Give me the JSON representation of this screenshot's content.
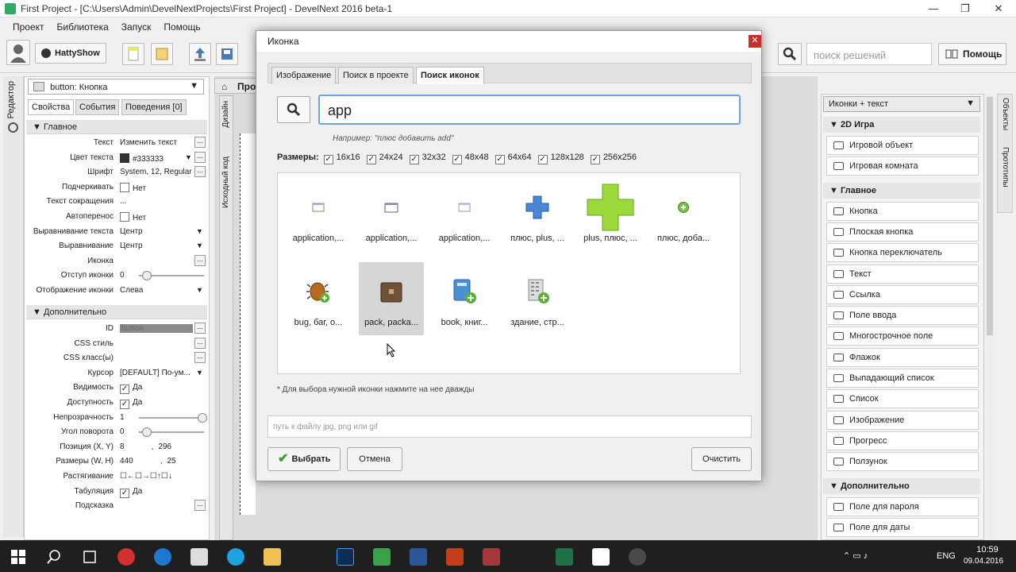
{
  "window": {
    "title": "First Project - [C:\\Users\\Admin\\DevelNextProjects\\First Project] - DevelNext 2016 beta-1"
  },
  "menu": [
    "Проект",
    "Библиотека",
    "Запуск",
    "Помощь"
  ],
  "toolbar": {
    "user": "HattyShow",
    "search_placeholder": "поиск решений",
    "help": "Помощь"
  },
  "editor_tab": "Редактор",
  "left": {
    "combo": "button: Кнопка",
    "tabs": [
      "Свойства",
      "События",
      "Поведения [0]"
    ],
    "main_section": "Главное",
    "extra_section": "Дополнительно",
    "props": [
      {
        "label": "Текст",
        "value": "Изменить текст",
        "dots": true
      },
      {
        "label": "Цвет текста",
        "value": "#333333",
        "swatch": true,
        "drop": true,
        "dots": true
      },
      {
        "label": "Шрифт",
        "value": "System, 12, Regular",
        "dots": true
      },
      {
        "label": "Подчеркивать",
        "value": "Нет",
        "check": false
      },
      {
        "label": "Текст сокращения",
        "value": "..."
      },
      {
        "label": "Автоперенос",
        "value": "Нет",
        "check": false
      },
      {
        "label": "Выравнивание текста",
        "value": "Центр",
        "drop": true
      },
      {
        "label": "Выравнивание",
        "value": "Центр",
        "drop": true
      },
      {
        "label": "Иконка",
        "value": "",
        "dots": true
      },
      {
        "label": "Отступ иконки",
        "value": "0",
        "slider": 0.05
      },
      {
        "label": "Отображение иконки",
        "value": "Слева",
        "drop": true
      }
    ],
    "props2": [
      {
        "label": "ID",
        "value": "button",
        "dots": true,
        "hl": true
      },
      {
        "label": "CSS стиль",
        "value": "",
        "dots": true
      },
      {
        "label": "CSS класс(ы)",
        "value": "",
        "dots": true
      },
      {
        "label": "Курсор",
        "value": "[DEFAULT] По-ум...",
        "drop": true
      },
      {
        "label": "Видимость",
        "value": "Да",
        "check": true
      },
      {
        "label": "Доступность",
        "value": "Да",
        "check": true
      },
      {
        "label": "Непрозрачность",
        "value": "1",
        "slider": 1
      },
      {
        "label": "Угол поворота",
        "value": "0",
        "slider": 0.05
      },
      {
        "label": "Позиция (X, Y)",
        "value": "8",
        "value2": "296"
      },
      {
        "label": "Размеры (W, H)",
        "value": "440",
        "value2": "25"
      },
      {
        "label": "Растягивание",
        "value": "☐←☐→☐↑☐↓"
      },
      {
        "label": "Табуляция",
        "value": "Да",
        "check": true
      },
      {
        "label": "Подсказка",
        "value": "",
        "dots": true
      }
    ]
  },
  "center": {
    "tab": "Про",
    "vtabs": [
      "Дизайн",
      "Исходный код"
    ]
  },
  "dialog": {
    "title": "Иконка",
    "tabs": [
      "Изображение",
      "Поиск в проекте",
      "Поиск иконок"
    ],
    "query": "app",
    "hint": "Например: \"плюс добавить add\"",
    "sizes_label": "Размеры:",
    "sizes": [
      "16x16",
      "24x24",
      "32x32",
      "48x48",
      "64x64",
      "128x128",
      "256x256"
    ],
    "icons": [
      {
        "label": "application,...",
        "kind": "win-s"
      },
      {
        "label": "application,...",
        "kind": "win-m"
      },
      {
        "label": "application,...",
        "kind": "win-s2"
      },
      {
        "label": "плюс, plus, ...",
        "kind": "plus-blue"
      },
      {
        "label": "plus, плюс, ...",
        "kind": "plus-green"
      },
      {
        "label": "плюс, доба...",
        "kind": "plus-circle"
      },
      {
        "label": "bug, баг, о...",
        "kind": "bug"
      },
      {
        "label": "pack, packa...",
        "kind": "pack"
      },
      {
        "label": "book, книг...",
        "kind": "book"
      },
      {
        "label": "здание, стр...",
        "kind": "building"
      }
    ],
    "note": "* Для выбора нужной иконки нажмите на нее дважды",
    "path_placeholder": "путь к файлу jpg, png или gif",
    "ok": "Выбрать",
    "cancel": "Отмена",
    "clear": "Очистить"
  },
  "right": {
    "combo": "Иконки + текст",
    "side_tabs": [
      "Объекты",
      "Прототипы"
    ],
    "sections": [
      {
        "title": "2D Игра",
        "items": [
          "Игровой объект",
          "Игровая комната"
        ]
      },
      {
        "title": "Главное",
        "items": [
          "Кнопка",
          "Плоская кнопка",
          "Кнопка переключатель",
          "Текст",
          "Ссылка",
          "Поле ввода",
          "Многострочное поле",
          "Флажок",
          "Выпадающий список",
          "Список",
          "Изображение",
          "Прогресс",
          "Ползунок"
        ]
      },
      {
        "title": "Дополнительно",
        "items": [
          "Поле для пароля",
          "Поле для даты"
        ]
      }
    ]
  },
  "taskbar": {
    "lang": "ENG",
    "time": "10:59",
    "date": "09.04.2016"
  }
}
